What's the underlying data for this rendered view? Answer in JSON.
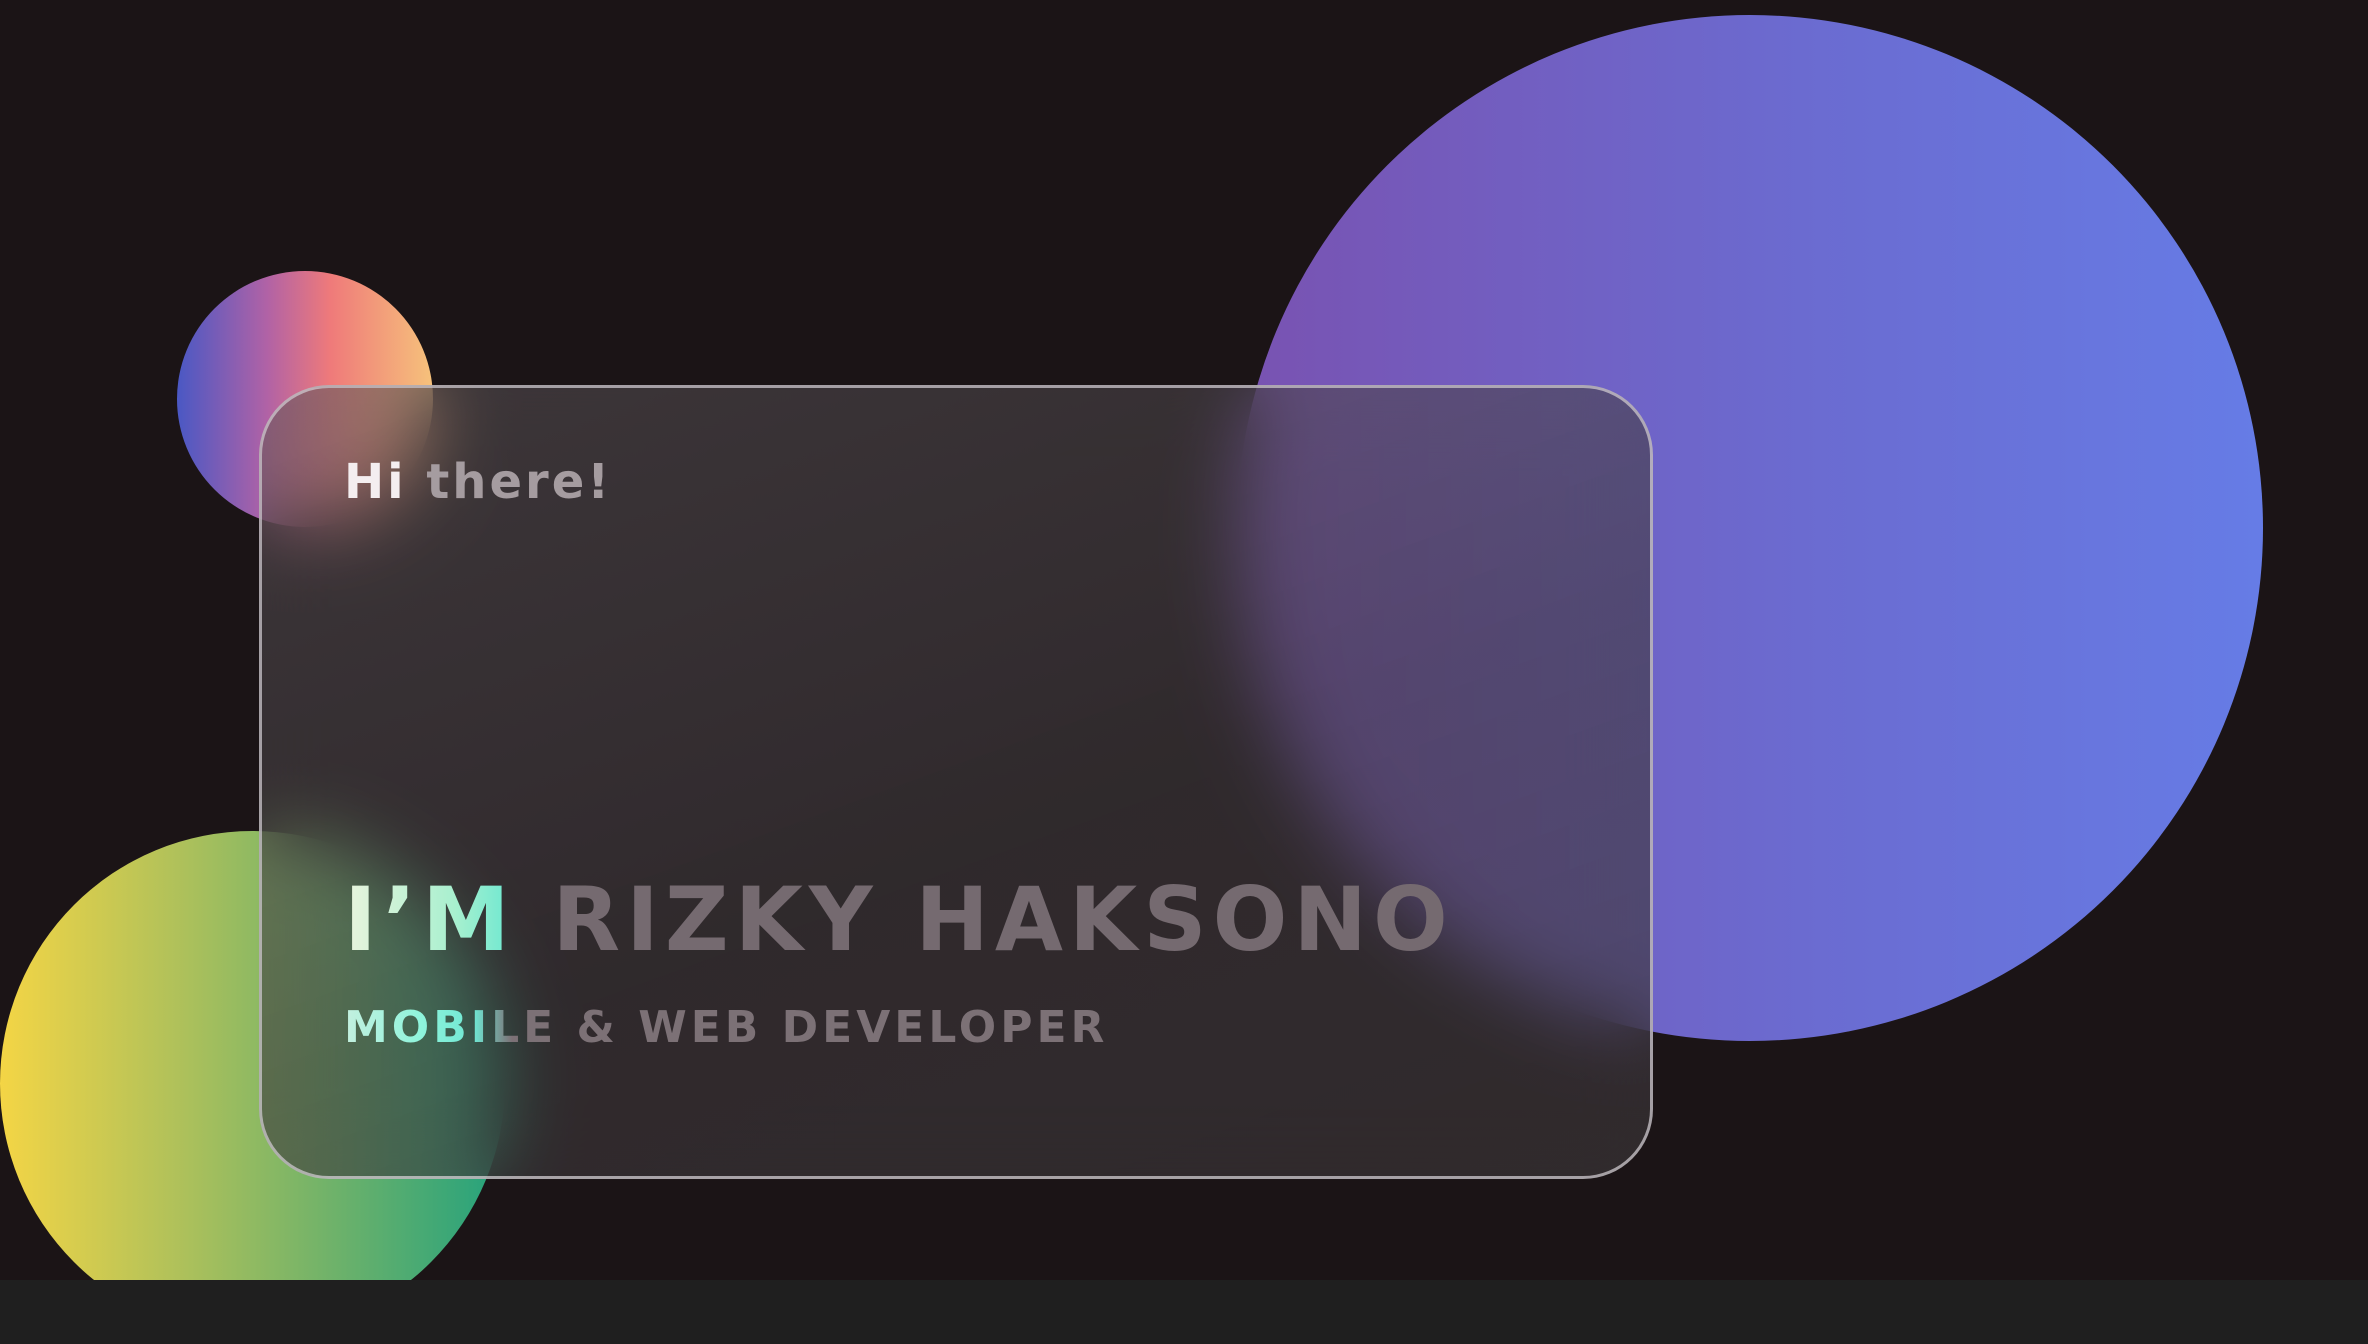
{
  "hero": {
    "greeting_hi": "Hi",
    "greeting_rest": "there!",
    "name": "I’M RIZKY HAKSONO",
    "role": "MOBILE & WEB DEVELOPER"
  },
  "colors": {
    "background": "#1b1416",
    "bottom_strip": "#1f1f1f",
    "big_circle_gradient": [
      "#7952b1",
      "#6b6bd0",
      "#667ce6"
    ],
    "small_circle_gradient": [
      "#4a58c4",
      "#b062a6",
      "#ef7a7a",
      "#f6c27b"
    ],
    "green_circle_gradient": [
      "#f4d545",
      "#b0c15a",
      "#66b06c",
      "#23a27d"
    ],
    "card_border": "#cdc8cd",
    "text_muted": "#756a70",
    "text_accent": "#6ee8d0"
  }
}
